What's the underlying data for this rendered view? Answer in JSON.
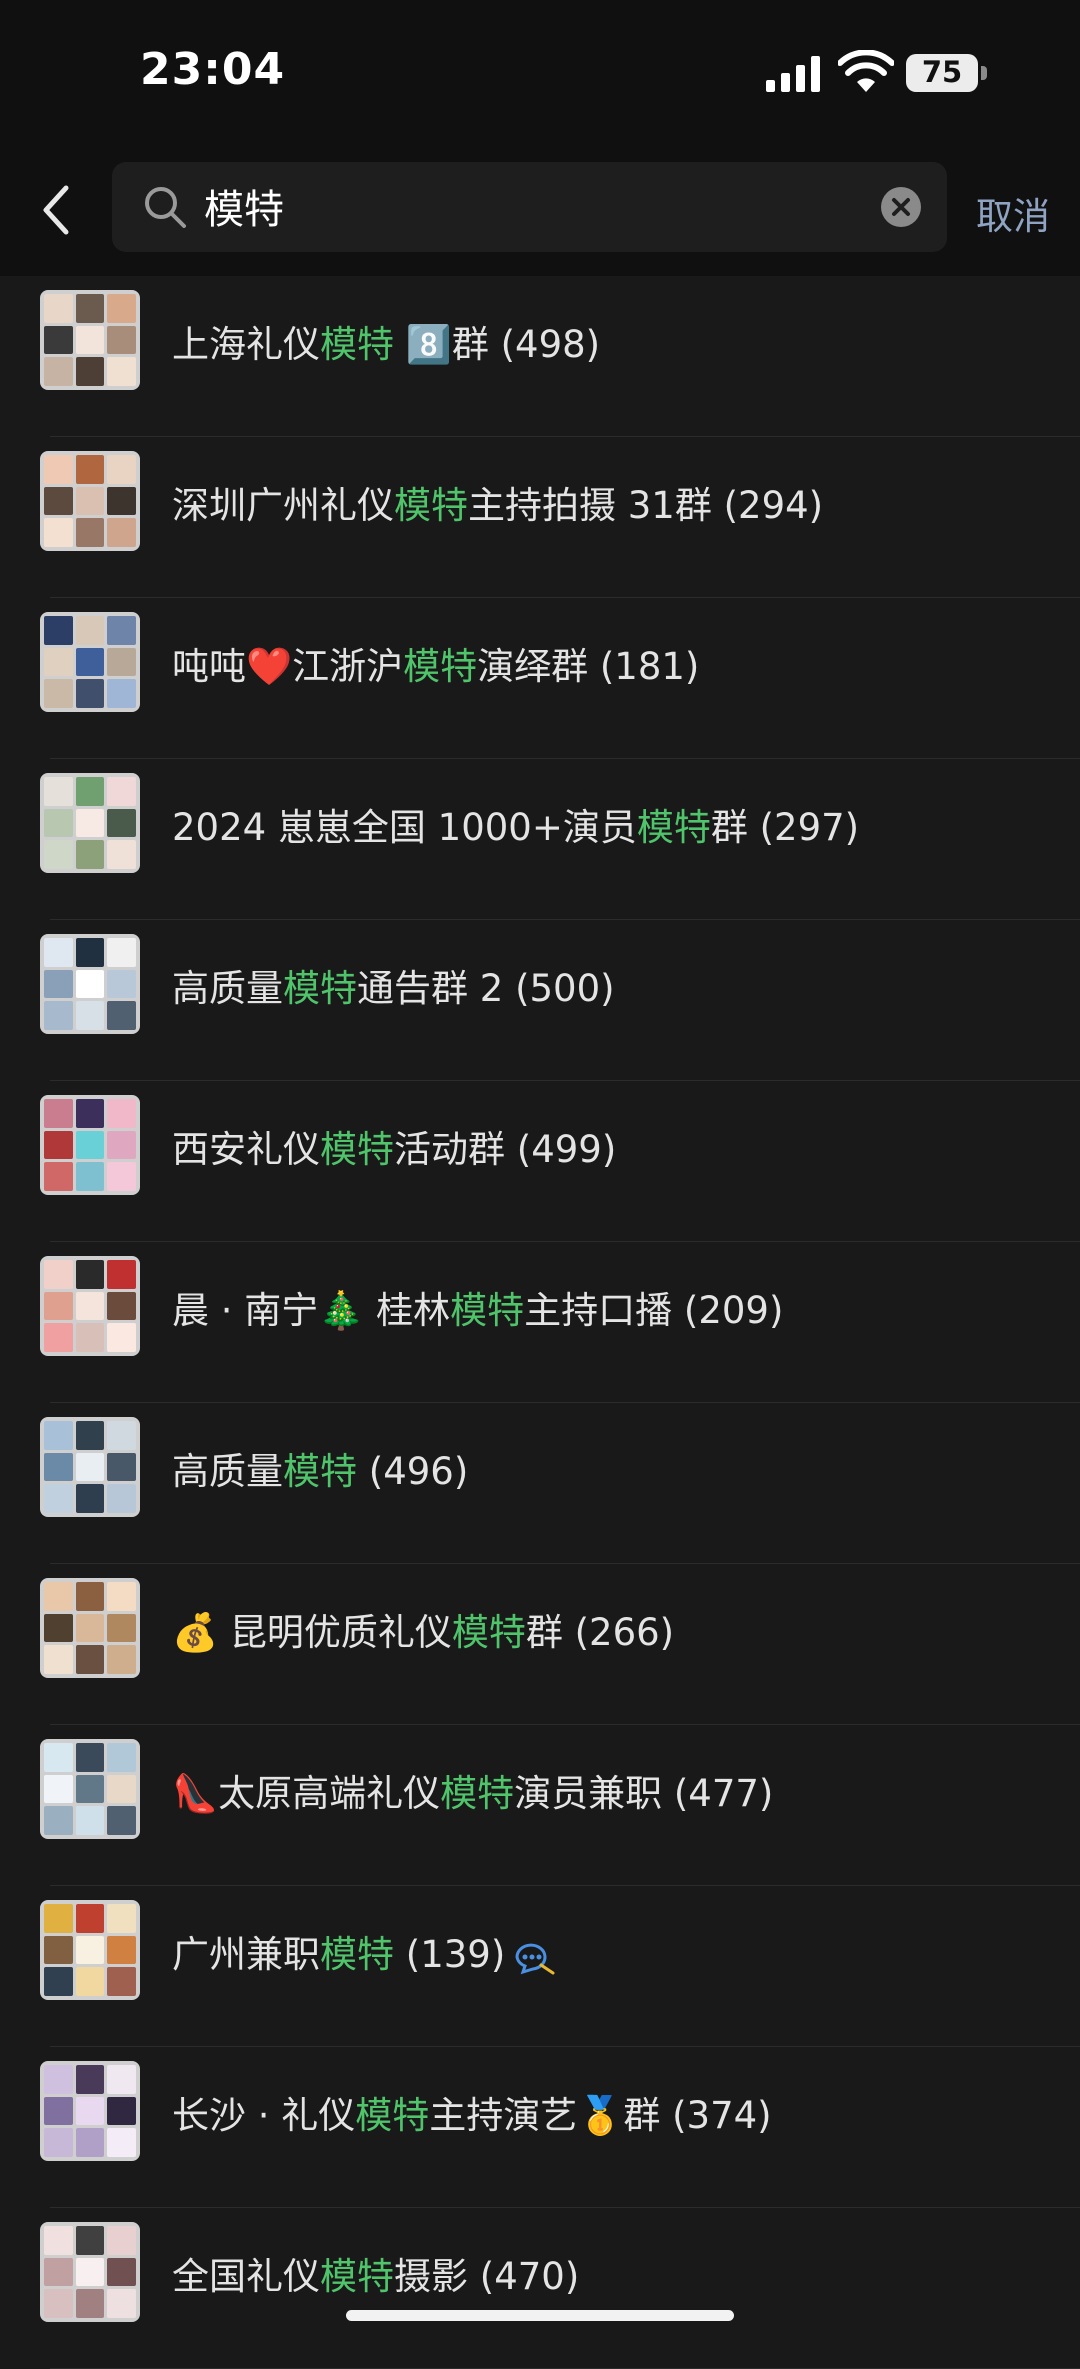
{
  "status": {
    "time": "23:04",
    "battery": "75"
  },
  "search": {
    "query": "模特",
    "cancel_label": "取消"
  },
  "results": [
    {
      "prefix": "上海礼仪",
      "highlight": "模特",
      "suffix": " 8️⃣群 (498)",
      "trail": ""
    },
    {
      "prefix": "深圳广州礼仪",
      "highlight": "模特",
      "suffix": "主持拍摄 31群 (294)",
      "trail": ""
    },
    {
      "prefix": "吨吨❤️江浙沪",
      "highlight": "模特",
      "suffix": "演绎群 (181)",
      "trail": ""
    },
    {
      "prefix": "2024 崽崽全国 1000+演员",
      "highlight": "模特",
      "suffix": "群 (297)",
      "trail": ""
    },
    {
      "prefix": "高质量",
      "highlight": "模特",
      "suffix": "通告群 2 (500)",
      "trail": ""
    },
    {
      "prefix": "西安礼仪",
      "highlight": "模特",
      "suffix": "活动群 (499)",
      "trail": ""
    },
    {
      "prefix": "晨 · 南宁🎄 桂林",
      "highlight": "模特",
      "suffix": "主持口播 (209)",
      "trail": ""
    },
    {
      "prefix": "高质量",
      "highlight": "模特",
      "suffix": " (496)",
      "trail": ""
    },
    {
      "prefix": "💰 昆明优质礼仪",
      "highlight": "模特",
      "suffix": "群 (266)",
      "trail": ""
    },
    {
      "prefix": "👠太原高端礼仪",
      "highlight": "模特",
      "suffix": "演员兼职 (477)",
      "trail": ""
    },
    {
      "prefix": "广州兼职",
      "highlight": "模特",
      "suffix": " (139)",
      "trail": "chat-mute-icon"
    },
    {
      "prefix": "长沙 · 礼仪",
      "highlight": "模特",
      "suffix": "主持演艺🥇群 (374)",
      "trail": ""
    },
    {
      "prefix": "全国礼仪",
      "highlight": "模特",
      "suffix": "摄影 (470)",
      "trail": ""
    }
  ]
}
